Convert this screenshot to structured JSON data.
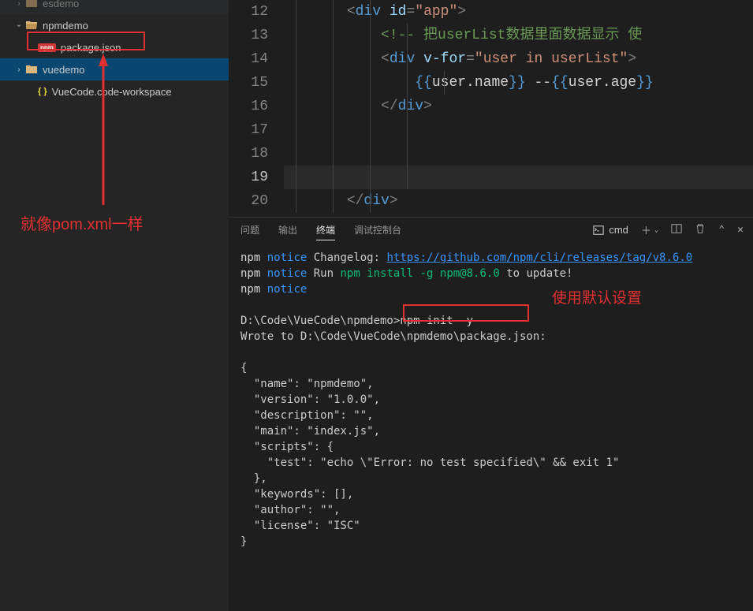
{
  "sidebar": {
    "items": [
      {
        "label": "esdemo",
        "type": "folder",
        "chevron": ">",
        "indent": 1
      },
      {
        "label": "npmdemo",
        "type": "folder",
        "chevron": "v",
        "indent": 1
      },
      {
        "label": "package.json",
        "type": "npm-file",
        "indent": 2,
        "highlighted": true
      },
      {
        "label": "vuedemo",
        "type": "folder",
        "chevron": ">",
        "indent": 1,
        "selected": true
      },
      {
        "label": "VueCode.code-workspace",
        "type": "json-file",
        "indent": 2
      }
    ]
  },
  "annotation": {
    "sidebar_text": "就像pom.xml一样",
    "terminal_text": "使用默认设置"
  },
  "editor": {
    "lines": [
      {
        "num": 12,
        "indent": 3,
        "html": "<div id=\"app\">"
      },
      {
        "num": 13,
        "indent": 4,
        "html": "<!-- 把userList数据里面数据显示 使"
      },
      {
        "num": 14,
        "indent": 4,
        "html": "<div v-for=\"user in userList\">"
      },
      {
        "num": 15,
        "indent": 5,
        "html": "{{user.name}} --{{user.age}}"
      },
      {
        "num": 16,
        "indent": 4,
        "html": "</div>"
      },
      {
        "num": 17,
        "indent": 0,
        "html": ""
      },
      {
        "num": 18,
        "indent": 0,
        "html": ""
      },
      {
        "num": 19,
        "indent": 0,
        "html": "",
        "current": true
      },
      {
        "num": 20,
        "indent": 3,
        "html": "</div>"
      }
    ]
  },
  "panel_tabs": {
    "problems": "问题",
    "output": "输出",
    "terminal": "终端",
    "debug": "调试控制台"
  },
  "panel_actions": {
    "shell_label": "cmd"
  },
  "terminal": {
    "lines": [
      "npm notice Changelog: https://github.com/npm/cli/releases/tag/v8.6.0",
      "npm notice Run npm install -g npm@8.6.0 to update!",
      "npm notice",
      "",
      "D:\\Code\\VueCode\\npmdemo>npm init -y",
      "Wrote to D:\\Code\\VueCode\\npmdemo\\package.json:",
      "",
      "{",
      "  \"name\": \"npmdemo\",",
      "  \"version\": \"1.0.0\",",
      "  \"description\": \"\",",
      "  \"main\": \"index.js\",",
      "  \"scripts\": {",
      "    \"test\": \"echo \\\"Error: no test specified\\\" && exit 1\"",
      "  },",
      "  \"keywords\": [],",
      "  \"author\": \"\",",
      "  \"license\": \"ISC\"",
      "}"
    ]
  }
}
